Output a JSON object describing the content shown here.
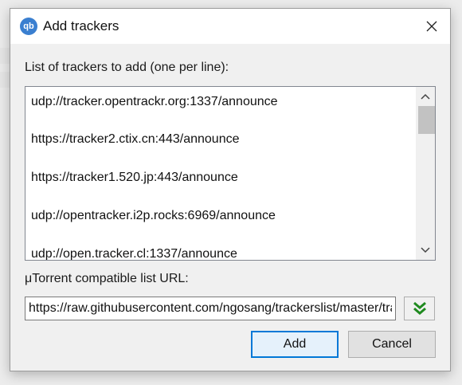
{
  "window": {
    "title": "Add trackers",
    "app_icon_text": "qb"
  },
  "trackers_label": "List of trackers to add (one per line):",
  "trackers": [
    "udp://tracker.opentrackr.org:1337/announce",
    "https://tracker2.ctix.cn:443/announce",
    "https://tracker1.520.jp:443/announce",
    "udp://opentracker.i2p.rocks:6969/announce",
    "udp://open.tracker.cl:1337/announce"
  ],
  "url_label": "μTorrent compatible list URL:",
  "url_value": "https://raw.githubusercontent.com/ngosang/trackerslist/master/trackers_best.txt",
  "buttons": {
    "add": "Add",
    "cancel": "Cancel"
  },
  "colors": {
    "accent": "#0078d7",
    "download_icon": "#1f8a1f",
    "app_icon": "#3a7fd0"
  },
  "icons": {
    "app": "qbittorrent-icon",
    "close": "close-icon",
    "scroll_up": "chevron-up-icon",
    "scroll_down": "chevron-down-icon",
    "download": "double-chevron-down-icon"
  }
}
